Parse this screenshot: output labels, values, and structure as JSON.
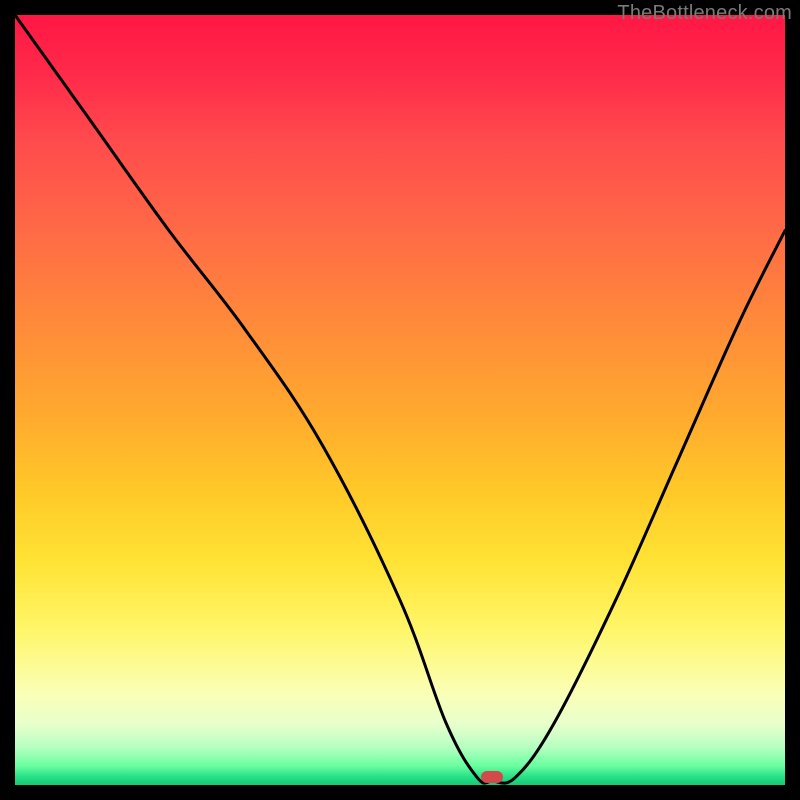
{
  "attribution": "TheBottleneck.com",
  "marker": {
    "x_pct": 62,
    "y_pct": 99
  },
  "chart_data": {
    "type": "line",
    "title": "",
    "xlabel": "",
    "ylabel": "",
    "xlim": [
      0,
      100
    ],
    "ylim": [
      0,
      100
    ],
    "background_gradient": {
      "orientation": "vertical",
      "stops": [
        {
          "pct": 0,
          "color": "#ff1744"
        },
        {
          "pct": 28,
          "color": "#ff6a46"
        },
        {
          "pct": 62,
          "color": "#ffc928"
        },
        {
          "pct": 88,
          "color": "#fbffb6"
        },
        {
          "pct": 99,
          "color": "#24df85"
        },
        {
          "pct": 100,
          "color": "#18c976"
        }
      ]
    },
    "series": [
      {
        "name": "bottleneck-curve",
        "x": [
          0,
          10,
          20,
          30,
          40,
          50,
          56,
          60,
          62,
          65,
          70,
          78,
          86,
          94,
          100
        ],
        "y": [
          100,
          86,
          72,
          59,
          44,
          24,
          8,
          1,
          0.5,
          1,
          8,
          24,
          42,
          60,
          72
        ]
      }
    ],
    "marker_point": {
      "x": 62,
      "y": 0.5,
      "color": "#d24a4a"
    }
  }
}
